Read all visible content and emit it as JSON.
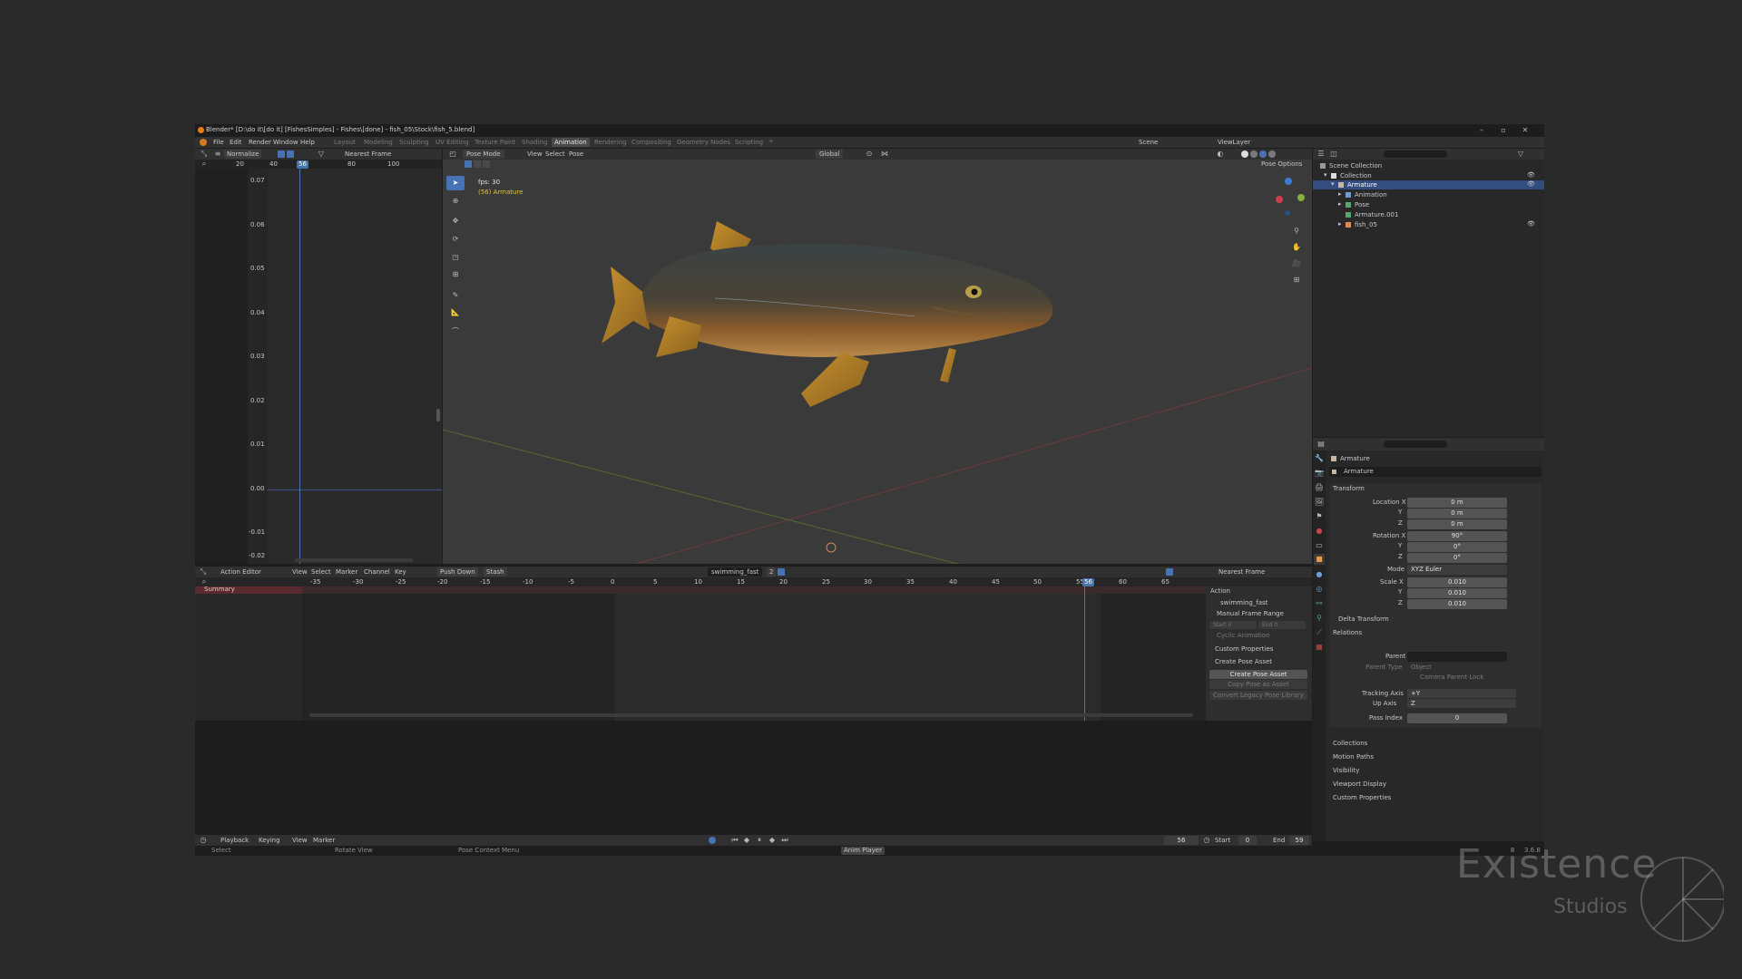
{
  "titlebar": {
    "title": "Blender* [D:\\do it\\[do it] [FishesSimples] - Fishes\\[done] - fish_05\\Stock\\fish_5.blend]"
  },
  "menu": [
    "File",
    "Edit",
    "Render",
    "Window",
    "Help"
  ],
  "workspaces": [
    "Layout",
    "Modeling",
    "Sculpting",
    "UV Editing",
    "Texture Paint",
    "Shading",
    "Animation",
    "Rendering",
    "Compositing",
    "Geometry Nodes",
    "Scripting"
  ],
  "active_workspace": "Animation",
  "scene": "Scene",
  "view_layer": "ViewLayer",
  "graph": {
    "normalize": "Normalize",
    "snap": "Nearest Frame",
    "frames": [
      "20",
      "40",
      "56",
      "60",
      "80",
      "100"
    ],
    "current_frame": "56",
    "y_ticks": [
      "0.07",
      "0.06",
      "0.05",
      "0.04",
      "0.03",
      "0.02",
      "0.01",
      "0.00",
      "-0.01",
      "-0.02",
      "-0.03"
    ]
  },
  "viewport": {
    "mode": "Pose Mode",
    "menus": [
      "View",
      "Select",
      "Pose"
    ],
    "orientation": "Global",
    "pose_options": "Pose Options",
    "fps": "fps: 30",
    "object": "(56) Armature"
  },
  "outliner": {
    "scene_collection": "Scene Collection",
    "items": [
      {
        "label": "Collection"
      },
      {
        "label": "Armature"
      },
      {
        "label": "Animation"
      },
      {
        "label": "Pose"
      },
      {
        "label": "Armature.001"
      },
      {
        "label": "fish_05"
      }
    ]
  },
  "properties": {
    "object_name": "Armature",
    "datablock": "Armature",
    "transform": "Transform",
    "location_label": "Location X",
    "rotation_label": "Rotation X",
    "scale_label": "Scale X",
    "axes": [
      "Y",
      "Z"
    ],
    "location": [
      "0 m",
      "0 m",
      "0 m"
    ],
    "rotation": [
      "90°",
      "0°",
      "0°"
    ],
    "mode_label": "Mode",
    "mode": "XYZ Euler",
    "scale": [
      "0.010",
      "0.010",
      "0.010"
    ],
    "delta": "Delta Transform",
    "relations": "Relations",
    "parent": "Parent",
    "parent_type": "Parent Type",
    "parent_type_value": "Object",
    "camera_lock": "Camera Parent Lock",
    "tracking_axis": "Tracking Axis",
    "tracking_value": "+Y",
    "up_axis": "Up Axis",
    "up_value": "Z",
    "pass_index": "Pass Index",
    "pass_value": "0",
    "sections": [
      "Collections",
      "Motion Paths",
      "Visibility",
      "Viewport Display",
      "Custom Properties"
    ]
  },
  "action_editor": {
    "mode": "Action Editor",
    "menus": [
      "View",
      "Select",
      "Marker",
      "Channel",
      "Key"
    ],
    "push_down": "Push Down",
    "stash": "Stash",
    "action": "swimming_fast",
    "users": "2",
    "snap": "Nearest Frame",
    "summary": "Summary",
    "frames": [
      "-35",
      "-30",
      "-25",
      "-20",
      "-15",
      "-10",
      "-5",
      "0",
      "5",
      "10",
      "15",
      "20",
      "25",
      "30",
      "35",
      "40",
      "45",
      "50",
      "55",
      "60",
      "65"
    ],
    "current_frame": "56"
  },
  "action_panel": {
    "title": "Action",
    "action_name": "swimming_fast",
    "manual_range": "Manual Frame Range",
    "start": "Start",
    "start_value": "0",
    "end": "End",
    "end_value": "0",
    "cyclic": "Cyclic Animation",
    "custom_props": "Custom Properties",
    "create_pose": "Create Pose Asset",
    "create_pose_btn": "Create Pose Asset",
    "copy_pose": "Copy Pose as Asset",
    "convert": "Convert Legacy Pose Library"
  },
  "timeline": {
    "menus": [
      "Playback",
      "Keying",
      "View",
      "Marker"
    ],
    "current": "56",
    "start_label": "Start",
    "start": "0",
    "end_label": "End",
    "end": "59"
  },
  "statusbar": {
    "select": "Select",
    "rotate": "Rotate View",
    "context": "Pose Context Menu",
    "anim": "Anim Player",
    "version": "3.6.8"
  },
  "watermark": {
    "line1": "Existence",
    "line2": "Studios"
  },
  "colors": {
    "accent": "#4772b3",
    "frame": "#5680c2",
    "fish_body": "#3a3f40",
    "fish_fin": "#c48d2a"
  }
}
